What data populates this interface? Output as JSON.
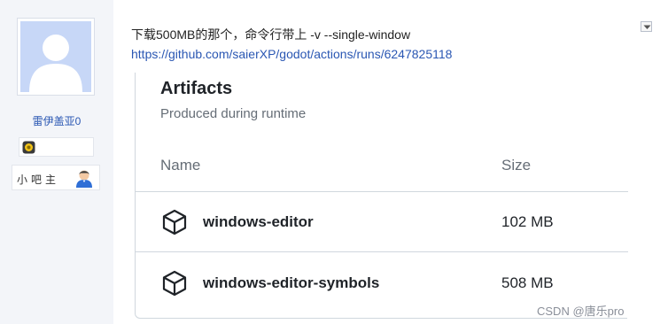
{
  "user": {
    "name": "雷伊盖亚0",
    "role": "小吧主",
    "avatar_icon": "default-avatar-icon",
    "level_icon": "level-badge-icon",
    "role_icon": "moderator-icon"
  },
  "post": {
    "text": "下载500MB的那个，命令行带上 -v --single-window",
    "link": "https://github.com/saierXP/godot/actions/runs/6247825118",
    "menu_icon": "chevron-down-icon"
  },
  "artifacts": {
    "title": "Artifacts",
    "subtitle": "Produced during runtime",
    "headers": {
      "name": "Name",
      "size": "Size"
    },
    "items": [
      {
        "name": "windows-editor",
        "size": "102 MB",
        "icon": "package-icon"
      },
      {
        "name": "windows-editor-symbols",
        "size": "508 MB",
        "icon": "package-icon"
      }
    ]
  },
  "watermark": "CSDN @唐乐pro",
  "colors": {
    "link": "#2a57b3",
    "sidebar_bg": "#f3f5f9",
    "avatar_bg": "#c7d7f7",
    "heading": "#1f2328",
    "muted": "#656d76",
    "border": "#d0d7de"
  }
}
